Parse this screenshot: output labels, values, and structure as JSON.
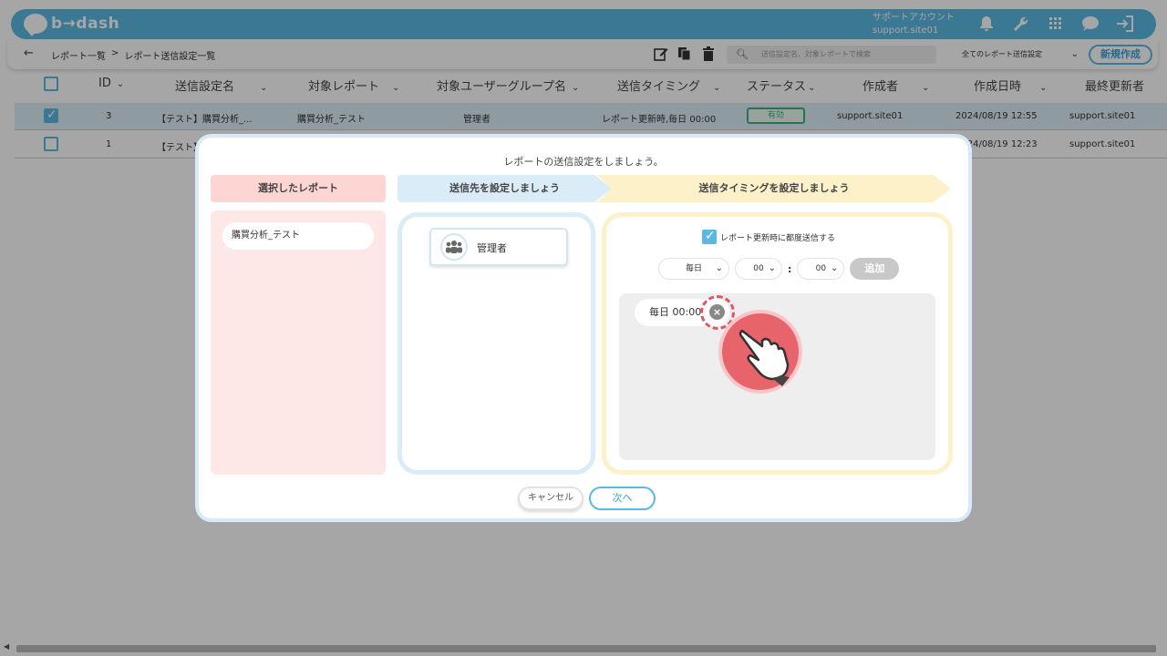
{
  "app": {
    "logo": "b→dash"
  },
  "account": {
    "line1": "サポートアカウント",
    "line2": "support.site01"
  },
  "breadcrumb": {
    "part1": "レポート一覧",
    "sep": ">",
    "part2": "レポート送信設定一覧"
  },
  "search": {
    "placeholder": "送信設定名、対象レポートで検索"
  },
  "filter": {
    "selected": "全てのレポート送信設定"
  },
  "new_button": "新規作成",
  "table": {
    "headers": {
      "id": "ID",
      "name": "送信設定名",
      "report": "対象レポート",
      "group": "対象ユーザーグループ名",
      "timing": "送信タイミング",
      "status": "ステータス",
      "creator": "作成者",
      "created": "作成日時",
      "updater": "最終更新者"
    },
    "rows": [
      {
        "checked": true,
        "id": "3",
        "name": "【テスト】購買分析_...",
        "report": "購買分析_テスト",
        "group": "管理者",
        "timing": "レポート更新時,毎日 00:00",
        "status": "有効",
        "creator": "support.site01",
        "created": "2024/08/19 12:55",
        "updater": "support.site01"
      },
      {
        "checked": false,
        "id": "1",
        "name": "【テスト】",
        "created": "2024/08/19 12:23",
        "updater": "support.site01"
      }
    ]
  },
  "modal": {
    "title": "レポートの送信設定をしましょう。",
    "step1": "選択したレポート",
    "step2": "送信先を設定しましょう",
    "step3": "送信タイミングを設定しましょう",
    "selected_report": "購買分析_テスト",
    "group_name": "管理者",
    "send_on_update": {
      "checked": true,
      "label": "レポート更新時に都度送信する"
    },
    "frequency": "毎日",
    "hour": "00",
    "minute": "00",
    "colon": ":",
    "add_button": "追加",
    "timings": [
      "毎日 00:00"
    ],
    "cancel_button": "キャンセル",
    "next_button": "次へ"
  },
  "colors": {
    "accent": "#5bb8e4",
    "status_active": "#3bb37a",
    "step1": "#fdd6d4",
    "step2": "#d9ecf8",
    "step3": "#fdf1ca",
    "pointer": "#e8646b"
  },
  "icons": [
    "bell-icon",
    "wrench-icon",
    "grid-icon",
    "chat-icon",
    "logout-icon",
    "back-arrow-icon",
    "edit-icon",
    "copy-icon",
    "trash-icon",
    "search-icon",
    "users-icon",
    "close-circle-icon",
    "hand-pointer-icon"
  ]
}
